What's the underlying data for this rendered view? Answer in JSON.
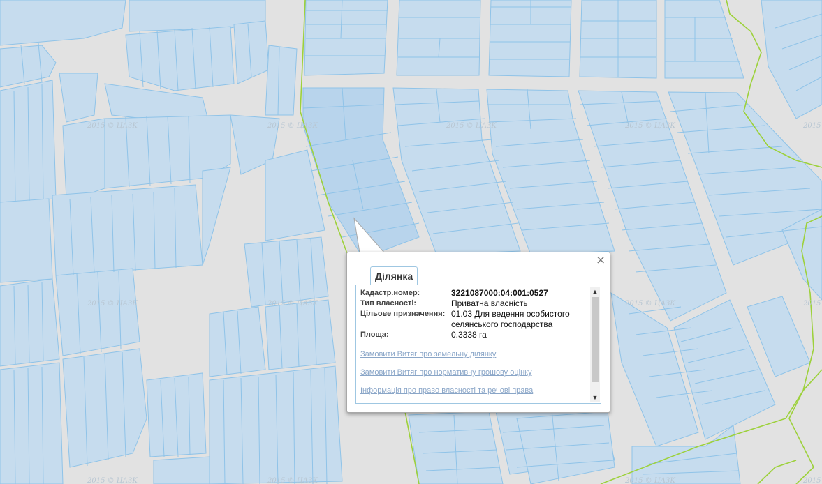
{
  "map": {
    "watermark": "2015 © ЦАЗК",
    "colors": {
      "background": "#e2e2e2",
      "parcel": "#c6dcee",
      "parcel_stroke": "#8fc3e8",
      "boundary": "#9dd13b"
    }
  },
  "popup": {
    "close_icon": "close-icon",
    "tab_label": "Ділянка",
    "fields": [
      {
        "label": "Кадастр.номер:",
        "value": "3221087000:04:001:0527"
      },
      {
        "label": "Тип власності:",
        "value": "Приватна власність"
      },
      {
        "label": "Цільове призначення:",
        "value": "01.03 Для ведення особистого селянського господарства"
      },
      {
        "label": "Площа:",
        "value": "0.3338 га"
      }
    ],
    "links": [
      "Замовити Витяг про земельну ділянку",
      "Замовити Витяг про нормативну грошову оцінку",
      "Інформація про право власності та речові права"
    ],
    "scroll_up_icon": "scroll-up-icon",
    "scroll_down_icon": "scroll-down-icon"
  }
}
